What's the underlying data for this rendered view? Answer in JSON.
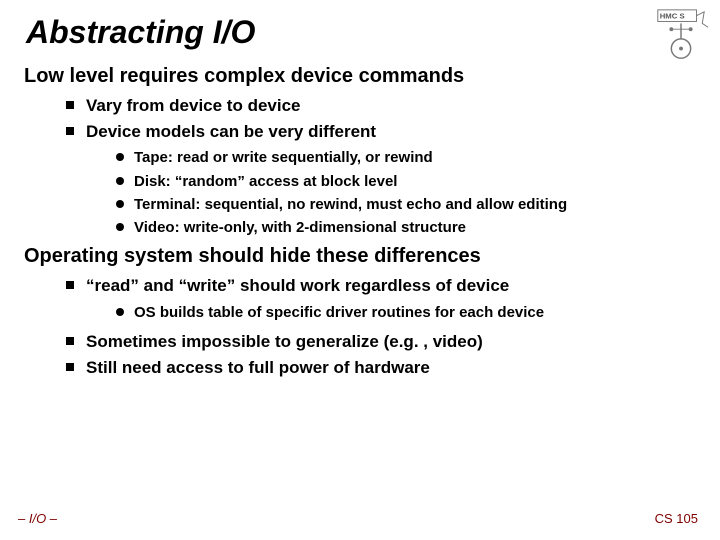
{
  "title": "Abstracting I/O",
  "s1": {
    "heading": "Low level requires complex device commands",
    "b1": "Vary from device to device",
    "b2": "Device models can be very different",
    "sub": {
      "i1": "Tape: read or write sequentially, or rewind",
      "i2": "Disk: “random” access at block level",
      "i3": "Terminal: sequential, no rewind, must echo and allow editing",
      "i4": "Video: write-only, with 2-dimensional structure"
    }
  },
  "s2": {
    "heading": "Operating system should hide these differences",
    "b1": "“read” and “write” should work regardless of device",
    "sub": {
      "i1": "OS builds table of specific driver routines for each device"
    },
    "b2": "Sometimes impossible to generalize (e.g. , video)",
    "b3": "Still need access to full power of hardware"
  },
  "footer": {
    "left": "– I/O –",
    "right": "CS 105"
  }
}
